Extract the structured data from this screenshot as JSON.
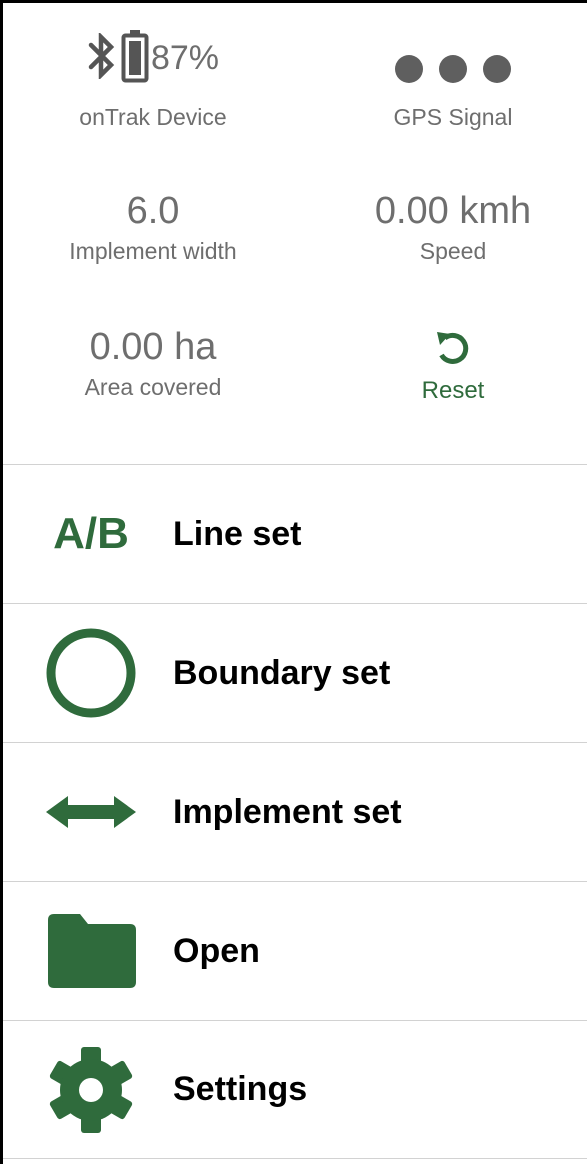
{
  "status": {
    "device": {
      "battery_percent": "87%",
      "label": "onTrak Device"
    },
    "gps": {
      "label": "GPS Signal"
    },
    "implement_width": {
      "value": "6.0",
      "label": "Implement width"
    },
    "speed": {
      "value": "0.00 kmh",
      "label": "Speed"
    },
    "area": {
      "value": "0.00 ha",
      "label": "Area covered"
    },
    "reset": {
      "label": "Reset"
    }
  },
  "menu": {
    "items": [
      {
        "icon": "ab-line-icon",
        "icon_text": "A/B",
        "label": "Line set"
      },
      {
        "icon": "circle-outline-icon",
        "label": "Boundary set"
      },
      {
        "icon": "double-arrow-icon",
        "label": "Implement set"
      },
      {
        "icon": "folder-icon",
        "label": "Open"
      },
      {
        "icon": "gear-icon",
        "label": "Settings"
      }
    ]
  },
  "colors": {
    "accent": "#2f6b3c",
    "muted_text": "#6e6e6e",
    "divider": "#d2d2d2"
  }
}
